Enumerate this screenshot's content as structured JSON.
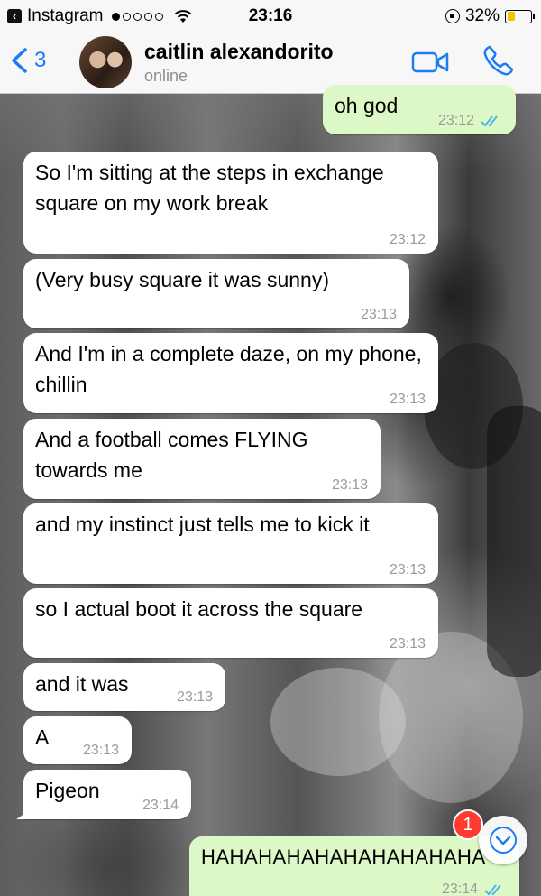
{
  "status_bar": {
    "back_app": "Instagram",
    "time": "23:16",
    "battery_percent": "32%",
    "battery_level": 0.32
  },
  "header": {
    "back_count": "3",
    "contact_name": "caitlin alexandorito",
    "contact_status": "online"
  },
  "messages": [
    {
      "text": "oh god",
      "time": "23:12",
      "direction": "out",
      "status": "read"
    },
    {
      "text": "So I'm sitting at the steps in exchange square on my work break",
      "time": "23:12",
      "direction": "in"
    },
    {
      "text": "(Very busy square it was sunny)",
      "time": "23:13",
      "direction": "in"
    },
    {
      "text": "And I'm in a complete daze, on my phone, chillin",
      "time": "23:13",
      "direction": "in"
    },
    {
      "text": "And a football comes FLYING towards me",
      "time": "23:13",
      "direction": "in"
    },
    {
      "text": "and my instinct just tells me to kick it",
      "time": "23:13",
      "direction": "in"
    },
    {
      "text": "so I actual boot it across the square",
      "time": "23:13",
      "direction": "in"
    },
    {
      "text": "and it was",
      "time": "23:13",
      "direction": "in"
    },
    {
      "text": "A",
      "time": "23:13",
      "direction": "in"
    },
    {
      "text": "Pigeon",
      "time": "23:14",
      "direction": "in"
    },
    {
      "text": "HAHAHAHAHAHAHAHAHAHA",
      "time": "23:14",
      "direction": "out",
      "status": "read"
    }
  ],
  "scroll_button": {
    "unread_count": "1"
  },
  "colors": {
    "outgoing_bubble": "#dcf8c6",
    "incoming_bubble": "#ffffff",
    "accent": "#1b7cf6",
    "read_ticks": "#4fb5ec",
    "badge": "#ff3b30",
    "battery": "#f2c300"
  },
  "icons": {
    "back": "chevron-left-icon",
    "video": "video-camera-icon",
    "call": "phone-icon",
    "scroll": "chevron-down-icon"
  }
}
